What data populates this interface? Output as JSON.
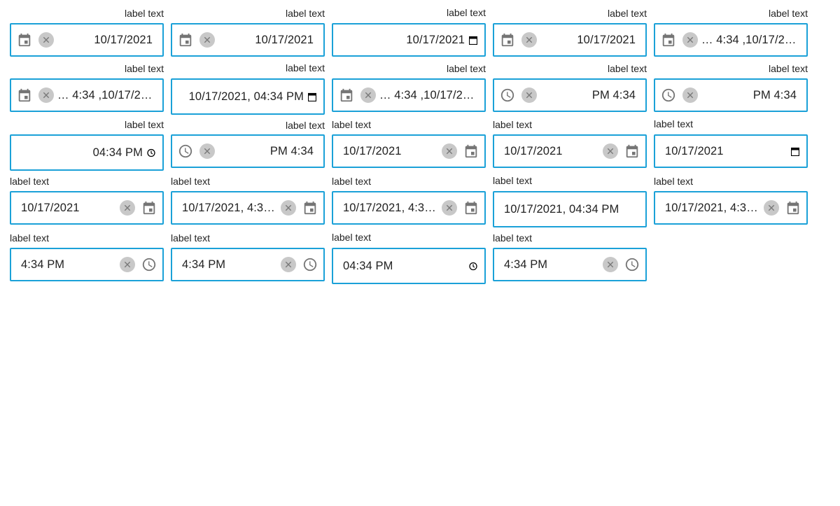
{
  "label": "label text",
  "colors": {
    "border": "#1ba1d8",
    "icon": "#757575",
    "clear_bg": "#c8c8c8"
  },
  "fields": [
    {
      "id": "r1c1",
      "value": "10/17/2021",
      "dir": "rtl",
      "icon": "calendar-icon",
      "clear": true
    },
    {
      "id": "r1c2",
      "value": "10/17/2021",
      "dir": "rtl",
      "icon": "calendar-icon",
      "clear": true
    },
    {
      "id": "r1c3",
      "value": "10/17/2021",
      "dir": "native",
      "icon": "native-calendar-icon",
      "clear": false
    },
    {
      "id": "r1c4",
      "value": "10/17/2021",
      "dir": "rtl",
      "icon": "calendar-icon",
      "clear": true
    },
    {
      "id": "r1c5",
      "value": "… 4:34 ,10/17/2021",
      "dir": "rtl",
      "icon": "calendar-icon",
      "clear": true
    },
    {
      "id": "r2c1",
      "value": "… 4:34 ,10/17/2021",
      "dir": "rtl",
      "icon": "calendar-icon",
      "clear": true
    },
    {
      "id": "r2c2",
      "value": "10/17/2021, 04:34 PM",
      "dir": "native",
      "icon": "native-calendar-icon",
      "clear": false
    },
    {
      "id": "r2c3",
      "value": "… 4:34 ,10/17/2021",
      "dir": "rtl",
      "icon": "calendar-icon",
      "clear": true
    },
    {
      "id": "r2c4",
      "value": "PM 4:34",
      "dir": "rtl",
      "icon": "clock-icon",
      "clear": true
    },
    {
      "id": "r2c5",
      "value": "PM 4:34",
      "dir": "rtl",
      "icon": "clock-icon",
      "clear": true
    },
    {
      "id": "r3c1",
      "value": "04:34 PM",
      "dir": "native",
      "icon": "native-clock-icon",
      "clear": false
    },
    {
      "id": "r3c2",
      "value": "PM 4:34",
      "dir": "rtl",
      "icon": "clock-icon",
      "clear": true
    },
    {
      "id": "r3c3",
      "value": "10/17/2021",
      "dir": "ltr",
      "icon": "calendar-icon",
      "clear": true
    },
    {
      "id": "r3c4",
      "value": "10/17/2021",
      "dir": "ltr",
      "icon": "calendar-icon",
      "clear": true
    },
    {
      "id": "r3c5",
      "value": "10/17/2021",
      "dir": "ltr-native",
      "icon": "native-calendar-icon",
      "clear": false
    },
    {
      "id": "r4c1",
      "value": "10/17/2021",
      "dir": "ltr",
      "icon": "calendar-icon",
      "clear": true
    },
    {
      "id": "r4c2",
      "value": "10/17/2021, 4:34 …",
      "dir": "ltr",
      "icon": "calendar-icon",
      "clear": true
    },
    {
      "id": "r4c3",
      "value": "10/17/2021, 4:34 …",
      "dir": "ltr",
      "icon": "calendar-icon",
      "clear": true
    },
    {
      "id": "r4c4",
      "value": "10/17/2021, 04:34 PM",
      "dir": "ltr-plain",
      "icon": "",
      "clear": false
    },
    {
      "id": "r4c5",
      "value": "10/17/2021, 4:34 …",
      "dir": "ltr",
      "icon": "calendar-icon",
      "clear": true
    },
    {
      "id": "r5c1",
      "value": "4:34 PM",
      "dir": "ltr",
      "icon": "clock-icon",
      "clear": true
    },
    {
      "id": "r5c2",
      "value": "4:34 PM",
      "dir": "ltr",
      "icon": "clock-icon",
      "clear": true
    },
    {
      "id": "r5c3",
      "value": "04:34 PM",
      "dir": "ltr-native",
      "icon": "native-clock-icon",
      "clear": false
    },
    {
      "id": "r5c4",
      "value": "4:34 PM",
      "dir": "ltr",
      "icon": "clock-icon",
      "clear": true
    }
  ]
}
